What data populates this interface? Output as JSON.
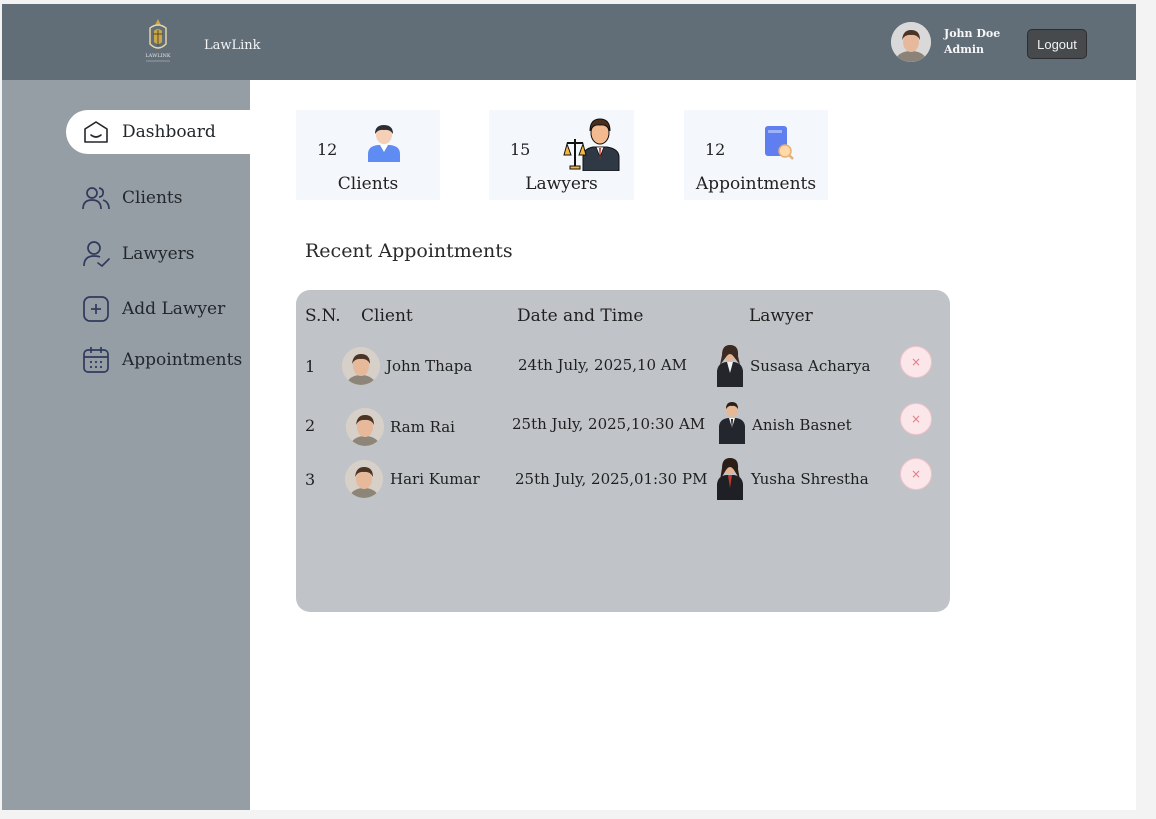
{
  "header": {
    "brand": "LawLink",
    "logo_text": "LAWLINK",
    "user": {
      "name": "John Doe",
      "role": "Admin"
    },
    "logout_label": "Logout"
  },
  "sidebar": {
    "items": [
      {
        "label": "Dashboard",
        "icon": "home-icon",
        "active": true
      },
      {
        "label": "Clients",
        "icon": "users-icon"
      },
      {
        "label": "Lawyers",
        "icon": "user-check-icon"
      },
      {
        "label": "Add Lawyer",
        "icon": "plus-square-icon"
      },
      {
        "label": "Appointments",
        "icon": "calendar-icon"
      }
    ]
  },
  "stats": [
    {
      "count": "12",
      "label": "Clients",
      "icon": "client-icon"
    },
    {
      "count": "15",
      "label": "Lawyers",
      "icon": "lawyer-scales-icon"
    },
    {
      "count": "12",
      "label": "Appointments",
      "icon": "appointment-book-icon"
    }
  ],
  "recent": {
    "title": "Recent Appointments",
    "headers": {
      "sn": "S.N.",
      "client": "Client",
      "datetime": "Date and Time",
      "lawyer": "Lawyer"
    },
    "rows": [
      {
        "sn": "1",
        "client": "John Thapa",
        "datetime": "24th July, 2025,10 AM",
        "lawyer": "Susasa Acharya"
      },
      {
        "sn": "2",
        "client": "Ram Rai",
        "datetime": "25th July, 2025,10:30 AM",
        "lawyer": "Anish Basnet"
      },
      {
        "sn": "3",
        "client": "Hari Kumar",
        "datetime": "25th July, 2025,01:30 PM",
        "lawyer": "Yusha Shrestha"
      }
    ],
    "delete_symbol": "×"
  },
  "colors": {
    "header_bg": "#616e78",
    "sidebar_bg": "#969ea5",
    "table_bg": "#c0c3c7",
    "card_bg": "#f4f7fb",
    "delete_btn": "#fbe7e9"
  }
}
